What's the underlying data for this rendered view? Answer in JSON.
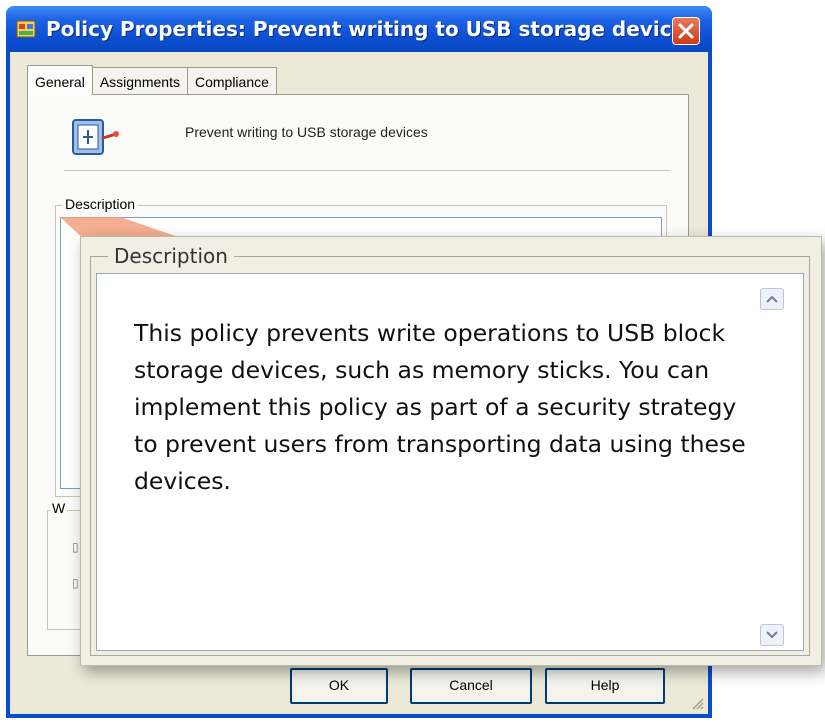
{
  "window": {
    "title": "Policy Properties: Prevent writing to USB storage devices",
    "title_icon": "policy-app-icon",
    "close_icon": "close-x-icon"
  },
  "tabs": [
    {
      "label": "General",
      "active": true
    },
    {
      "label": "Assignments",
      "active": false
    },
    {
      "label": "Compliance",
      "active": false
    }
  ],
  "policy": {
    "icon": "usb-policy-icon",
    "name": "Prevent writing to USB storage devices"
  },
  "groups": {
    "description_label": "Description",
    "partial_label": "W"
  },
  "buttons": {
    "ok": "OK",
    "cancel": "Cancel",
    "help": "Help"
  },
  "callout": {
    "label": "Description",
    "text": "This policy prevents write operations to USB block storage devices, such as memory sticks. You can implement this policy as part of a security strategy to prevent users from transporting data using these devices.",
    "scroll_up_icon": "scroll-up-arrow-icon",
    "scroll_down_icon": "scroll-down-arrow-icon"
  },
  "colors": {
    "titlebar": "#0b4fd2",
    "dialog_bg": "#ece9d8",
    "close_button": "#cd3a16",
    "callout_beam": "#f2a07e"
  }
}
